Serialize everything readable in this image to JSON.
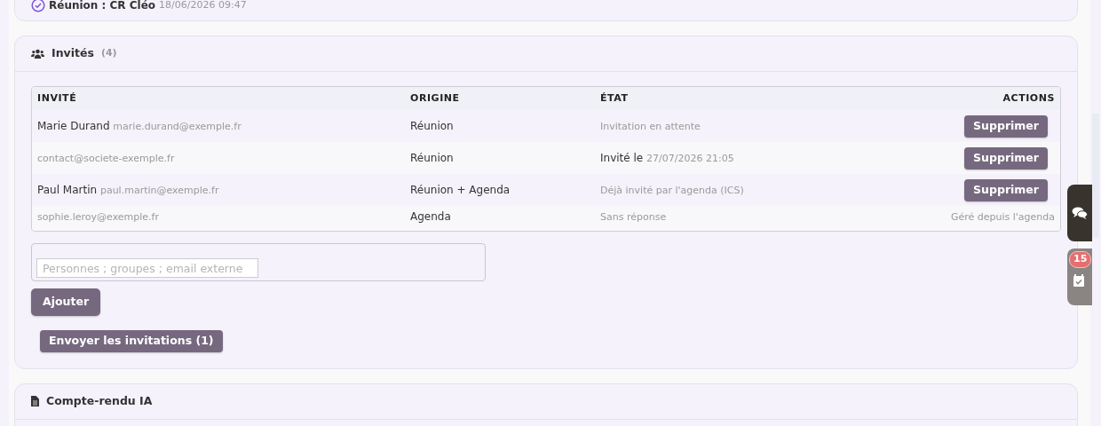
{
  "previous_card": {
    "item": {
      "checked": true,
      "title": "Réunion : CR Cléo",
      "date": "18/06/2026 09:47"
    }
  },
  "guests_card": {
    "title": "Invités",
    "count": "(4)",
    "table": {
      "columns": [
        "INVITÉ",
        "ORIGINE",
        "ÉTAT",
        "ACTIONS"
      ],
      "rows": [
        {
          "name": "Marie Durand",
          "email": "marie.durand@exemple.fr",
          "origin": "Réunion",
          "state": {
            "muted": true,
            "label": "Invitation en attente"
          },
          "action": {
            "kind": "button",
            "label": "Supprimer"
          }
        },
        {
          "email": "contact@societe-exemple.fr",
          "origin": "Réunion",
          "state": {
            "muted": false,
            "label": "Invité le",
            "date": "27/07/2026 21:05"
          },
          "action": {
            "kind": "button",
            "label": "Supprimer"
          }
        },
        {
          "name": "Paul Martin",
          "email": "paul.martin@exemple.fr",
          "origin": "Réunion + Agenda",
          "state": {
            "muted": true,
            "label": "Déjà invité par l'agenda (ICS)"
          },
          "action": {
            "kind": "button",
            "label": "Supprimer"
          }
        },
        {
          "email": "sophie.leroy@exemple.fr",
          "origin": "Agenda",
          "state": {
            "muted": true,
            "label": "Sans réponse"
          },
          "action": {
            "kind": "note",
            "text": "Géré depuis l'agenda"
          }
        }
      ]
    },
    "search": {
      "placeholder": "Personnes ; groupes ; email externe"
    },
    "add_button": "Ajouter",
    "send_button": "Envoyer les invitations (1)"
  },
  "report_card": {
    "title": "Compte-rendu IA"
  },
  "side_tabs": [
    {
      "kind": "chat"
    },
    {
      "kind": "tasks",
      "badge": "15"
    }
  ]
}
